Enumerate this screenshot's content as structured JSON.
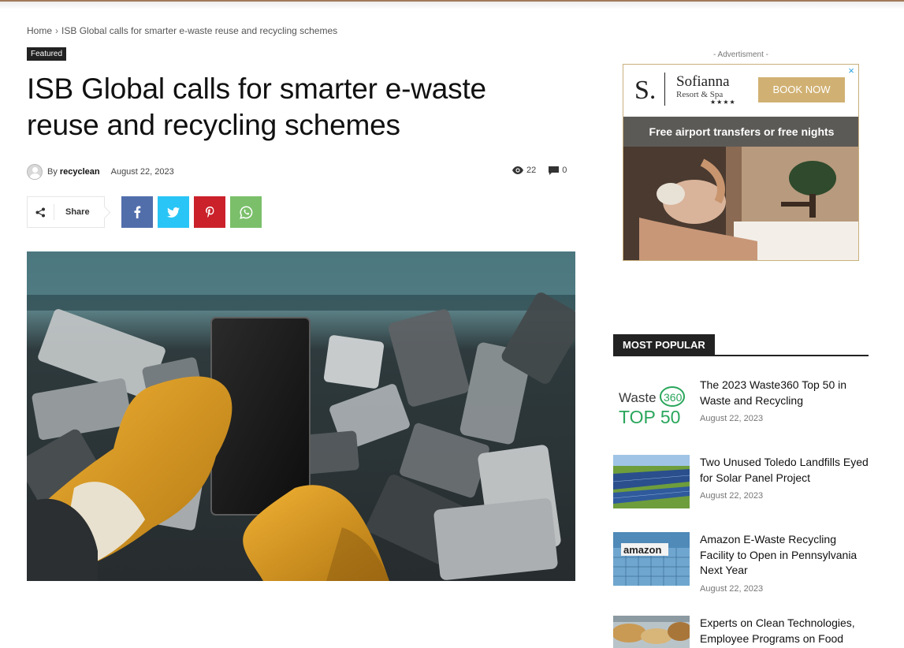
{
  "breadcrumb": {
    "home": "Home",
    "separator": "›",
    "current": "ISB Global calls for smarter e-waste reuse and recycling schemes"
  },
  "article": {
    "category_badge": "Featured",
    "title": "ISB Global calls for smarter e-waste reuse and recycling schemes",
    "by_label": "By",
    "author": "recyclean",
    "date": "August 22, 2023",
    "views": "22",
    "comments": "0",
    "share_label": "Share",
    "hero_image_icon": "e-waste-phones-photo"
  },
  "ad": {
    "label": "- Advertisment -",
    "logo_letter": "S.",
    "brand": "Sofianna",
    "brand_sub": "Resort & Spa",
    "stars": "★★★★",
    "cta": "BOOK NOW",
    "band_text": "Free airport transfers or free nights",
    "close_icon": "×"
  },
  "most_popular": {
    "heading": "MOST POPULAR",
    "items": [
      {
        "title": "The 2023 Waste360 Top 50 in Waste and Recycling",
        "date": "August 22, 2023",
        "thumb_text_a": "Waste",
        "thumb_text_b": "360",
        "thumb_text_c": "TOP 50"
      },
      {
        "title": "Two Unused Toledo Landfills Eyed for Solar Panel Project",
        "date": "August 22, 2023"
      },
      {
        "title": "Amazon E-Waste Recycling Facility to Open in Pennsylvania Next Year",
        "date": "August 22, 2023",
        "thumb_text_a": "amazon"
      },
      {
        "title": "Experts on Clean Technologies, Employee Programs on Food",
        "date": ""
      }
    ]
  },
  "colors": {
    "facebook": "#516eab",
    "twitter": "#29c5f6",
    "pinterest": "#ca212a",
    "whatsapp": "#7bbf6a",
    "ad_gold": "#d1b173"
  }
}
